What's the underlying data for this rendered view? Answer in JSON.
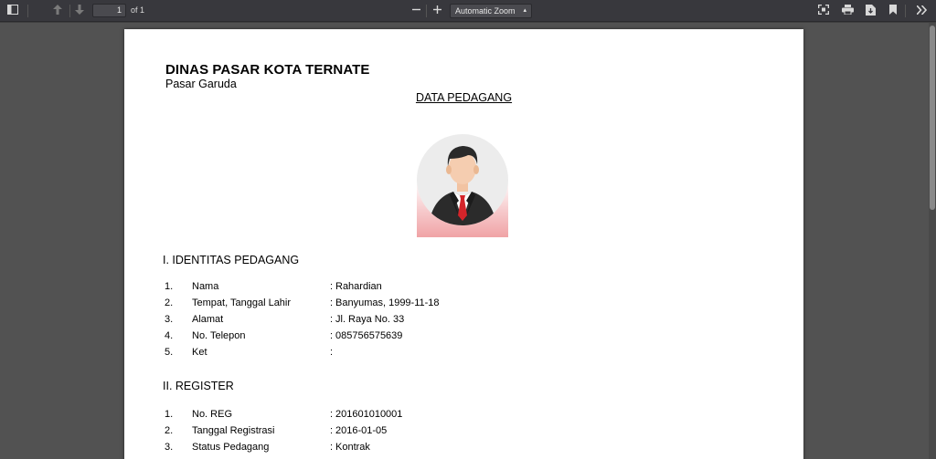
{
  "toolbar": {
    "page_number": "1",
    "page_count": "of 1",
    "zoom": "Automatic Zoom"
  },
  "document": {
    "org_name": "DINAS PASAR KOTA TERNATE",
    "org_sub": "Pasar Garuda",
    "title": "DATA PEDAGANG",
    "section1": {
      "title": "I. IDENTITAS PEDAGANG",
      "rows": [
        {
          "num": "1.",
          "label": "Nama",
          "value": "Rahardian"
        },
        {
          "num": "2.",
          "label": "Tempat, Tanggal Lahir",
          "value": "Banyumas, 1999-11-18"
        },
        {
          "num": "3.",
          "label": "Alamat",
          "value": "Jl. Raya No. 33"
        },
        {
          "num": "4.",
          "label": "No. Telepon",
          "value": "085756575639"
        },
        {
          "num": "5.",
          "label": "Ket",
          "value": ""
        }
      ]
    },
    "section2": {
      "title": "II. REGISTER",
      "rows": [
        {
          "num": "1.",
          "label": "No. REG",
          "value": "201601010001"
        },
        {
          "num": "2.",
          "label": "Tanggal Registrasi",
          "value": "2016-01-05"
        },
        {
          "num": "3.",
          "label": "Status Pedagang",
          "value": "Kontrak"
        }
      ]
    }
  },
  "icons": {
    "sidebar_toggle": "sidebar-toggle-icon",
    "prev_page": "arrow-up-icon",
    "next_page": "arrow-down-icon",
    "zoom_out": "minus-icon",
    "zoom_in": "plus-icon",
    "presentation": "fullscreen-icon",
    "print": "print-icon",
    "download": "download-icon",
    "bookmark": "bookmark-icon",
    "tools": "double-chevron-right-icon"
  },
  "colors": {
    "toolbar_bg": "#38383d",
    "viewer_bg": "#525252",
    "photo_gradient": "#f0a3a6",
    "tie": "#d4242a"
  }
}
